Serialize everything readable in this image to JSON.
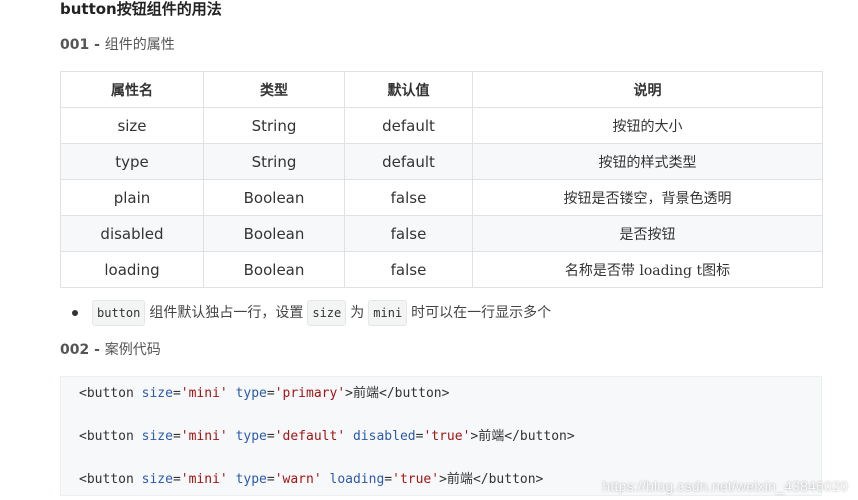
{
  "title": "button按钮组件的用法",
  "section1": {
    "number": "001 -",
    "name": "组件的属性"
  },
  "table": {
    "headers": [
      "属性名",
      "类型",
      "默认值",
      "说明"
    ],
    "rows": [
      [
        "size",
        "String",
        "default",
        "按钮的大小"
      ],
      [
        "type",
        "String",
        "default",
        "按钮的样式类型"
      ],
      [
        "plain",
        "Boolean",
        "false",
        "按钮是否镂空，背景色透明"
      ],
      [
        "disabled",
        "Boolean",
        "false",
        "是否按钮"
      ],
      [
        "loading",
        "Boolean",
        "false",
        "名称是否带 loading t图标"
      ]
    ]
  },
  "note": {
    "code1": "button",
    "text1": "组件默认独占一行，设置",
    "code2": "size",
    "text2": "为",
    "code3": "mini",
    "text3": "时可以在一行显示多个"
  },
  "section2": {
    "number": "002 -",
    "name": "案例代码"
  },
  "code": {
    "lines": [
      {
        "open": "<button",
        "a1": "size",
        "v1": "'mini'",
        "a2": "type",
        "v2": "'primary'",
        "a3": "",
        "v3": "",
        "text": "前端",
        "close": "</button>"
      },
      {
        "open": "<button",
        "a1": "size",
        "v1": "'mini'",
        "a2": "type",
        "v2": "'default'",
        "a3": "disabled",
        "v3": "'true'",
        "text": "前端",
        "close": "</button>"
      },
      {
        "open": "<button",
        "a1": "size",
        "v1": "'mini'",
        "a2": "type",
        "v2": "'warn'",
        "a3": "loading",
        "v3": "'true'",
        "text": "前端",
        "close": "</button>"
      }
    ]
  },
  "watermark": "https://blog.csdn.net/weixin_43846020"
}
